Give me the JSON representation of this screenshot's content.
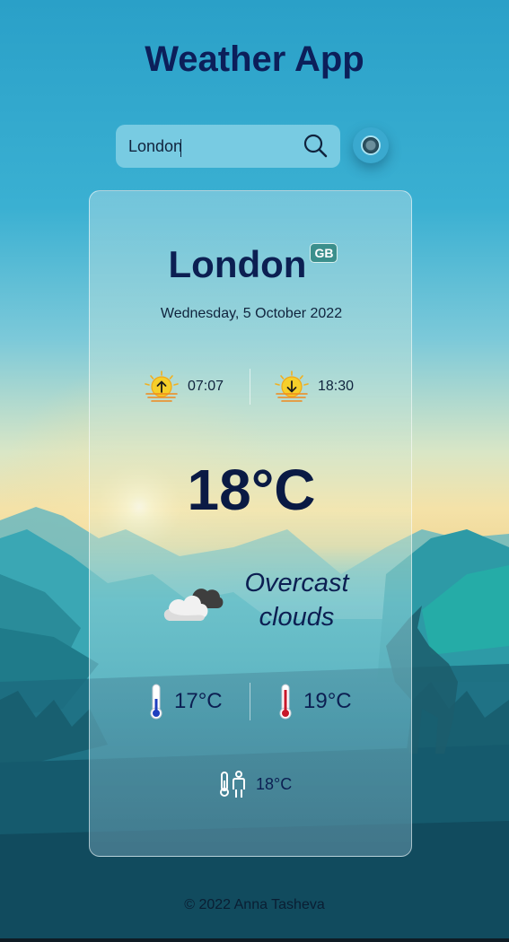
{
  "app": {
    "title": "Weather App"
  },
  "search": {
    "value": "London",
    "placeholder": ""
  },
  "weather": {
    "city": "London",
    "country_code": "GB",
    "date": "Wednesday, 5 October 2022",
    "sunrise": "07:07",
    "sunset": "18:30",
    "temperature": "18°C",
    "condition": "Overcast clouds",
    "temp_min": "17°C",
    "temp_max": "19°C",
    "feels_like": "18°C"
  },
  "icons": {
    "search": "search-icon",
    "theme_toggle": "theme-toggle-icon",
    "sunrise": "sunrise-icon",
    "sunset": "sunset-icon",
    "condition": "overcast-clouds-icon",
    "min": "thermometer-cold-icon",
    "max": "thermometer-hot-icon",
    "feels": "feels-like-icon"
  },
  "colors": {
    "title": "#0c1f5a",
    "badge": "#3b8f8c",
    "sun": "#f5cf2a"
  },
  "footer": {
    "text": "© 2022 Anna Tasheva"
  }
}
